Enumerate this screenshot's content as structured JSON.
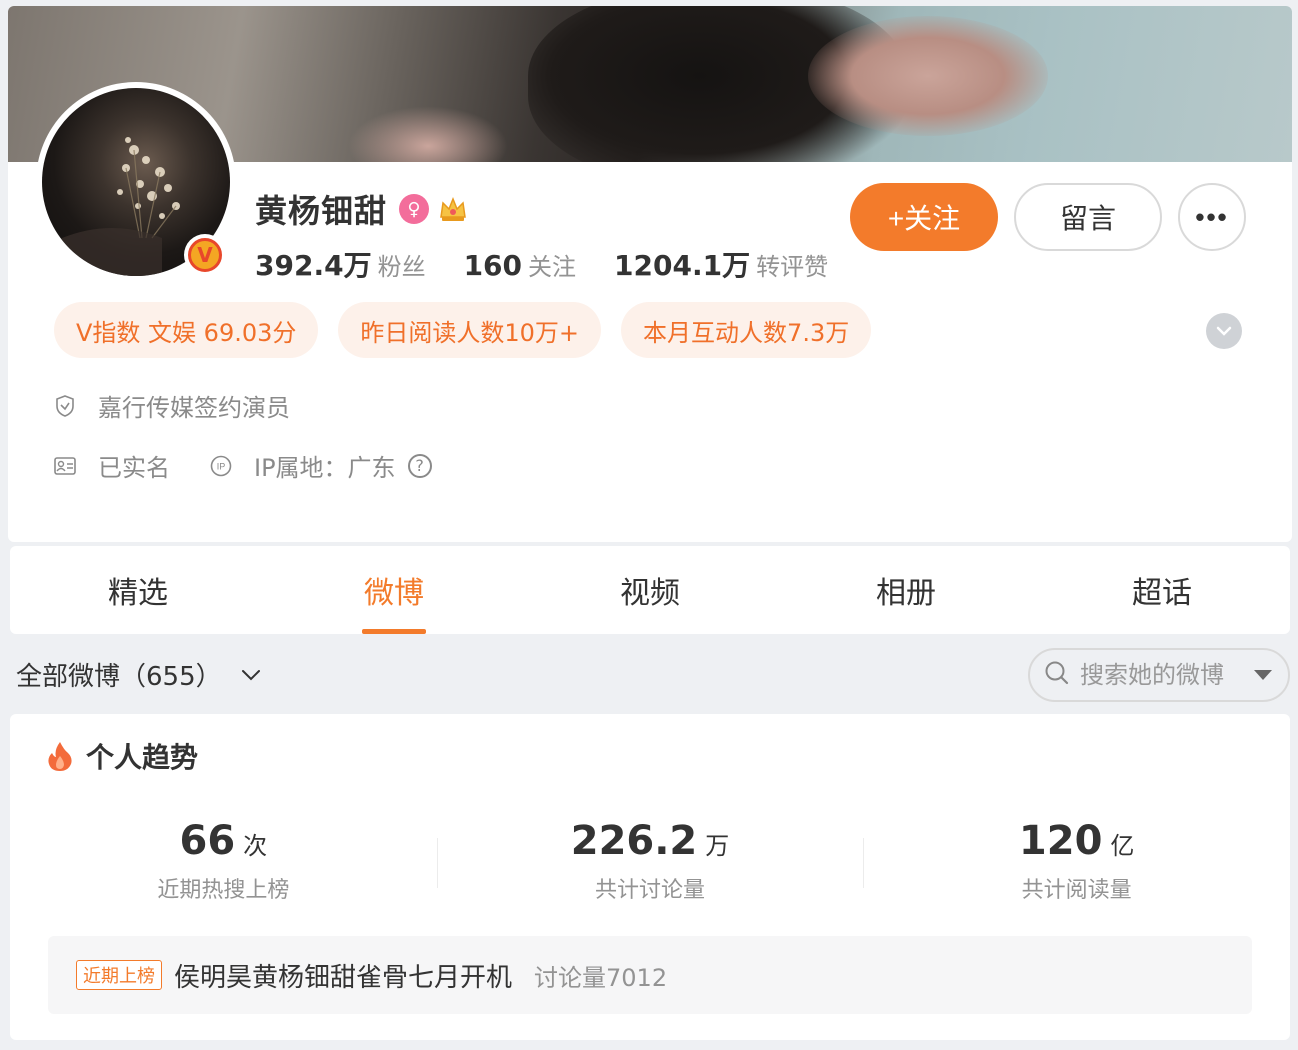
{
  "profile": {
    "name": "黄杨钿甜",
    "gender_icon": "female-icon",
    "crown_icon": "crown-icon",
    "verified_badge": "V",
    "stats": [
      {
        "num": "392.4万",
        "label": "粉丝"
      },
      {
        "num": "160",
        "label": "关注"
      },
      {
        "num": "1204.1万",
        "label": "转评赞"
      }
    ],
    "follow_label": "+关注",
    "message_label": "留言",
    "more_label": "•••",
    "tags": [
      "V指数 文娱 69.03分",
      "昨日阅读人数10万+",
      "本月互动人数7.3万"
    ],
    "info": {
      "company": "嘉行传媒签约演员",
      "realname": "已实名",
      "ip": "IP属地：广东",
      "help": "?"
    }
  },
  "tabs": [
    "精选",
    "微博",
    "视频",
    "相册",
    "超话"
  ],
  "active_tab": "微博",
  "filter": {
    "label": "全部微博（655）",
    "search_placeholder": "搜索她的微博"
  },
  "trend": {
    "title": "个人趋势",
    "metrics": [
      {
        "value": "66",
        "unit": "次",
        "desc": "近期热搜上榜"
      },
      {
        "value": "226.2",
        "unit": "万",
        "desc": "共计讨论量"
      },
      {
        "value": "120",
        "unit": "亿",
        "desc": "共计阅读量"
      }
    ],
    "hot": {
      "badge": "近期上榜",
      "text": "侯明昊黄杨钿甜雀骨七月开机",
      "count": "讨论量7012"
    }
  },
  "colors": {
    "accent": "#f37b2b",
    "tag_bg": "#fdf1ea",
    "page_bg": "#eef0f3"
  }
}
